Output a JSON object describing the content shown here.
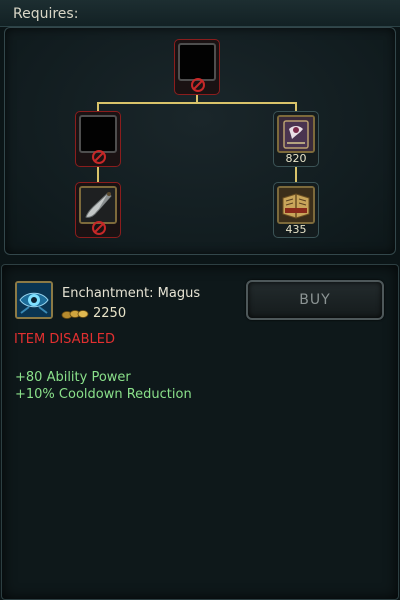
{
  "requires": {
    "title": "Requires:"
  },
  "tree": {
    "nodes": [
      {
        "id": "root",
        "state": "locked",
        "price": ""
      },
      {
        "id": "left-component",
        "state": "locked",
        "price": ""
      },
      {
        "id": "left-base",
        "state": "locked",
        "icon": "dagger-icon",
        "price": ""
      },
      {
        "id": "right-component",
        "state": "owned",
        "icon": "tome-icon",
        "price": "820"
      },
      {
        "id": "right-base",
        "state": "owned",
        "icon": "book-icon",
        "price": "435"
      }
    ]
  },
  "item": {
    "icon": "magus-eye-icon",
    "name": "Enchantment: Magus",
    "cost_icon": "gold-coins-icon",
    "cost": "2250",
    "status": "ITEM DISABLED",
    "stats": [
      "+80 Ability Power",
      "+10% Cooldown Reduction"
    ]
  },
  "buy_button": {
    "label": "BUY",
    "enabled": false
  },
  "colors": {
    "locked_border": "#8b1d1d",
    "disabled_text": "#e23030",
    "stat_text": "#8ae08a",
    "tree_line": "#d9c36a",
    "price_text": "#e8e3c8"
  }
}
